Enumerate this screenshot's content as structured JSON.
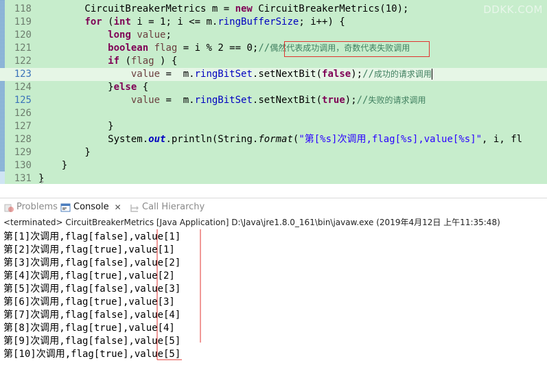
{
  "editor": {
    "watermark": "DDKK.COM",
    "lines": [
      {
        "num": "118",
        "tokens": [
          {
            "t": "        CircuitBreakerMetrics m = ",
            "c": ""
          },
          {
            "t": "new",
            "c": "kw"
          },
          {
            "t": " CircuitBreakerMetrics(10);",
            "c": ""
          }
        ]
      },
      {
        "num": "119",
        "tokens": [
          {
            "t": "        ",
            "c": ""
          },
          {
            "t": "for",
            "c": "kw"
          },
          {
            "t": " (",
            "c": ""
          },
          {
            "t": "int",
            "c": "kw"
          },
          {
            "t": " i = 1; i <= m.",
            "c": ""
          },
          {
            "t": "ringBufferSize",
            "c": "fld"
          },
          {
            "t": "; i++) {",
            "c": ""
          }
        ]
      },
      {
        "num": "120",
        "tokens": [
          {
            "t": "            ",
            "c": ""
          },
          {
            "t": "long",
            "c": "kw"
          },
          {
            "t": " ",
            "c": ""
          },
          {
            "t": "value",
            "c": "var"
          },
          {
            "t": ";",
            "c": ""
          }
        ]
      },
      {
        "num": "121",
        "tokens": [
          {
            "t": "            ",
            "c": ""
          },
          {
            "t": "boolean",
            "c": "kw"
          },
          {
            "t": " ",
            "c": ""
          },
          {
            "t": "flag",
            "c": "var"
          },
          {
            "t": " = i % 2 == 0;",
            "c": ""
          },
          {
            "t": "//",
            "c": "cmtm"
          },
          {
            "t": "偶然代表成功调用，奇数代表失败调用",
            "c": "cmt"
          }
        ]
      },
      {
        "num": "122",
        "tokens": [
          {
            "t": "            ",
            "c": ""
          },
          {
            "t": "if",
            "c": "kw"
          },
          {
            "t": " (",
            "c": ""
          },
          {
            "t": "flag",
            "c": "var"
          },
          {
            "t": " ) {",
            "c": ""
          }
        ]
      },
      {
        "num": "123",
        "current": true,
        "tokens": [
          {
            "t": "                ",
            "c": ""
          },
          {
            "t": "value",
            "c": "var"
          },
          {
            "t": " =  m.",
            "c": ""
          },
          {
            "t": "ringBitSet",
            "c": "fld"
          },
          {
            "t": ".setNextBit(",
            "c": ""
          },
          {
            "t": "false",
            "c": "kw"
          },
          {
            "t": ");",
            "c": ""
          },
          {
            "t": "//",
            "c": "cmtm"
          },
          {
            "t": "成功的请求调用",
            "c": "cmt"
          }
        ]
      },
      {
        "num": "124",
        "tokens": [
          {
            "t": "            }",
            "c": ""
          },
          {
            "t": "else",
            "c": "kw"
          },
          {
            "t": " {",
            "c": ""
          }
        ]
      },
      {
        "num": "125",
        "tokens": [
          {
            "t": "                ",
            "c": ""
          },
          {
            "t": "value",
            "c": "var"
          },
          {
            "t": " =  m.",
            "c": ""
          },
          {
            "t": "ringBitSet",
            "c": "fld"
          },
          {
            "t": ".setNextBit(",
            "c": ""
          },
          {
            "t": "true",
            "c": "kw"
          },
          {
            "t": ");",
            "c": ""
          },
          {
            "t": "//",
            "c": "cmtm"
          },
          {
            "t": "失败的请求调用",
            "c": "cmt"
          }
        ]
      },
      {
        "num": "126",
        "tokens": [
          {
            "t": "",
            "c": ""
          }
        ]
      },
      {
        "num": "127",
        "tokens": [
          {
            "t": "            }",
            "c": ""
          }
        ]
      },
      {
        "num": "128",
        "tokens": [
          {
            "t": "            System.",
            "c": ""
          },
          {
            "t": "out",
            "c": "italbold"
          },
          {
            "t": ".println(String.",
            "c": ""
          },
          {
            "t": "format",
            "c": "ital"
          },
          {
            "t": "(",
            "c": ""
          },
          {
            "t": "\"第[%s]次调用,flag[%s],value[%s]\"",
            "c": "str"
          },
          {
            "t": ", i, fl",
            "c": ""
          }
        ]
      },
      {
        "num": "129",
        "tokens": [
          {
            "t": "        }",
            "c": ""
          }
        ]
      },
      {
        "num": "130",
        "tokens": [
          {
            "t": "    }",
            "c": ""
          }
        ]
      },
      {
        "num": "131",
        "tokens": [
          {
            "t": "}",
            "c": ""
          }
        ]
      }
    ]
  },
  "tabs": [
    {
      "label": "Problems",
      "icon": "problems-icon",
      "active": false
    },
    {
      "label": "Console",
      "icon": "console-icon",
      "active": true
    },
    {
      "label": "Call Hierarchy",
      "icon": "call-hierarchy-icon",
      "active": false
    }
  ],
  "status": "<terminated> CircuitBreakerMetrics [Java Application] D:\\Java\\jre1.8.0_161\\bin\\javaw.exe (2019年4月12日 上午11:35:48)",
  "console_lines": [
    "第[1]次调用,flag[false],value[1]",
    "第[2]次调用,flag[true],value[1]",
    "第[3]次调用,flag[false],value[2]",
    "第[4]次调用,flag[true],value[2]",
    "第[5]次调用,flag[false],value[3]",
    "第[6]次调用,flag[true],value[3]",
    "第[7]次调用,flag[false],value[4]",
    "第[8]次调用,flag[true],value[4]",
    "第[9]次调用,flag[false],value[5]",
    "第[10]次调用,flag[true],value[5]"
  ],
  "colors": {
    "editor_bg": "#c7edcc",
    "annotation_red": "#e0332f"
  }
}
